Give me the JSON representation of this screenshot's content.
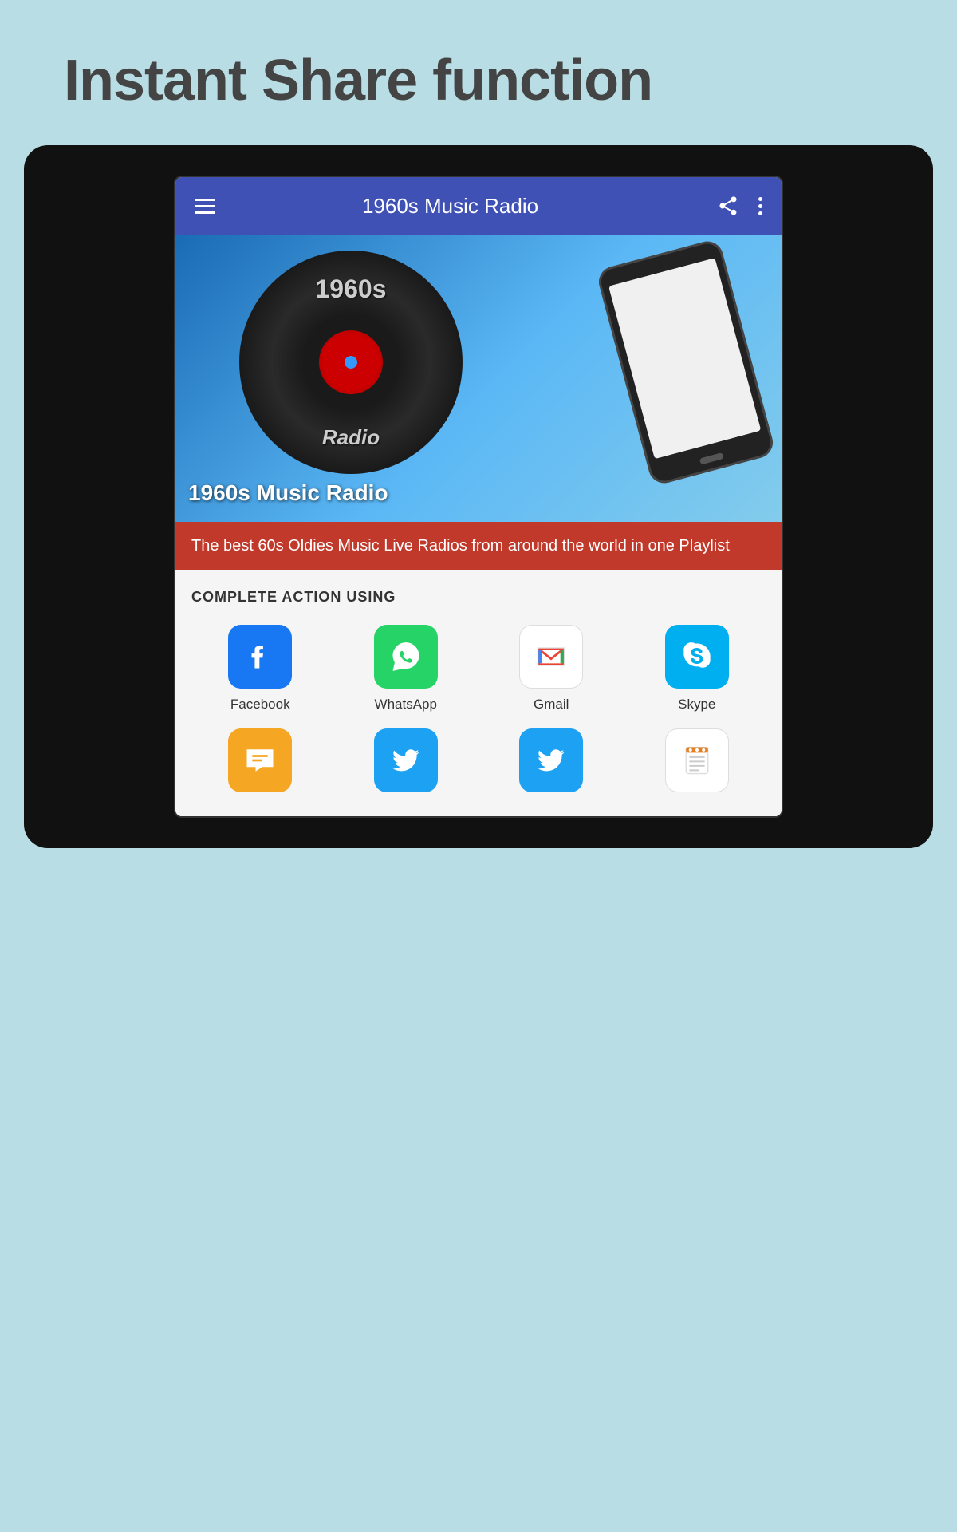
{
  "page": {
    "title": "Instant Share function",
    "background_color": "#b8dde4"
  },
  "app_bar": {
    "title": "1960s Music Radio",
    "menu_icon": "menu-icon",
    "share_icon": "share-icon",
    "more_icon": "more-icon"
  },
  "hero": {
    "vinyl_text_top": "1960s",
    "vinyl_text_bottom": "Radio",
    "overlay_title": "1960s Music Radio",
    "subtitle": "The best 60s Oldies Music Live Radios from around the world in one Playlist"
  },
  "action_section": {
    "title": "COMPLETE ACTION USING",
    "apps": [
      {
        "name": "Facebook",
        "icon_type": "facebook"
      },
      {
        "name": "WhatsApp",
        "icon_type": "whatsapp"
      },
      {
        "name": "Gmail",
        "icon_type": "gmail"
      },
      {
        "name": "Skype",
        "icon_type": "skype"
      }
    ],
    "apps_row2": [
      {
        "name": "Chat",
        "icon_type": "chat"
      },
      {
        "name": "Twitter",
        "icon_type": "twitter1"
      },
      {
        "name": "Twitter",
        "icon_type": "twitter2"
      },
      {
        "name": "Notes",
        "icon_type": "notes"
      }
    ]
  }
}
